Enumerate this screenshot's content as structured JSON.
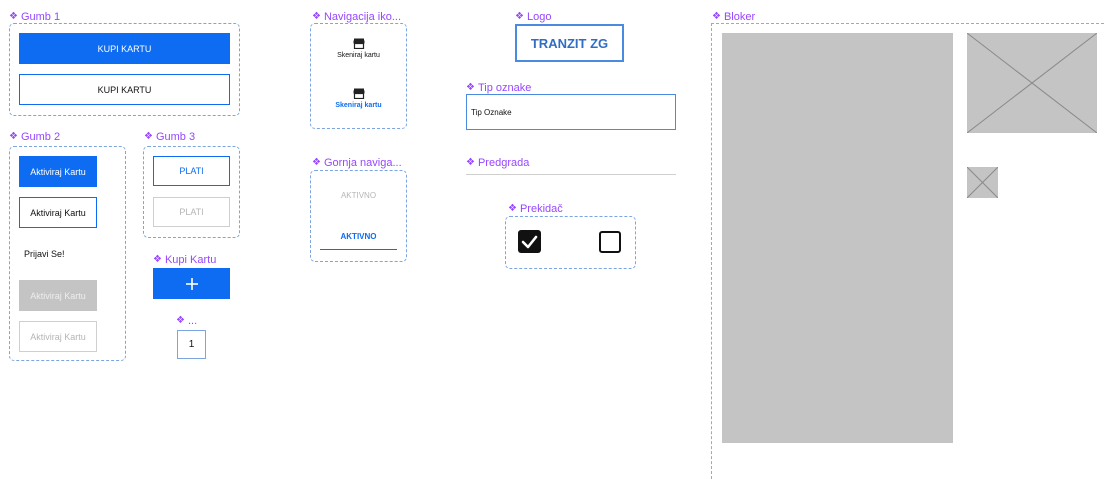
{
  "gumb1": {
    "label": "Gumb 1",
    "primary": "KUPI KARTU",
    "outline": "KUPI KARTU"
  },
  "gumb2": {
    "label": "Gumb 2",
    "primary": "Aktiviraj Kartu",
    "outline": "Aktiviraj Kartu",
    "text": "Prijavi Se!",
    "disabled_fill": "Aktiviraj Kartu",
    "disabled_outline": "Aktiviraj Kartu"
  },
  "gumb3": {
    "label": "Gumb 3",
    "active": "PLATI",
    "disabled": "PLATI"
  },
  "kupi_kartu": {
    "label": "Kupi Kartu",
    "icon": "plus-icon"
  },
  "counter": {
    "label": "...",
    "value": "1"
  },
  "navigacija": {
    "label": "Navigacija iko...",
    "items": [
      {
        "label": "Skeniraj kartu",
        "icon": "store-icon",
        "active": false
      },
      {
        "label": "Skeniraj kartu",
        "icon": "store-icon",
        "active": true
      }
    ]
  },
  "gornja": {
    "label": "Gornja naviga...",
    "inactive": "AKTIVNO",
    "active": "AKTIVNO"
  },
  "logo": {
    "label": "Logo",
    "text": "TRANZIT ZG"
  },
  "tip_oznake": {
    "label": "Tip oznake",
    "value": "Tip Oznake"
  },
  "predgrada": {
    "label": "Predgrada"
  },
  "prekidac": {
    "label": "Prekidač",
    "checked": true,
    "unchecked": false
  },
  "bloker": {
    "label": "Bloker"
  },
  "colors": {
    "primary": "#0d6cf2",
    "component_label": "#9747ff",
    "disabled_fill": "#c4c4c4",
    "placeholder": "#c4c4c4"
  }
}
